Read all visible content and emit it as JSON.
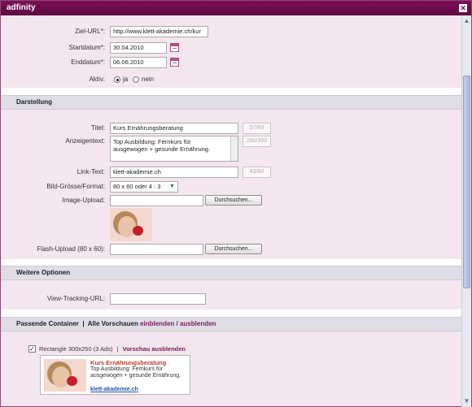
{
  "window": {
    "title": "adfinity",
    "close_glyph": "✕"
  },
  "form": {
    "ziel_url": {
      "label": "Ziel-URL*:",
      "value": "http://www.klett-akademie.ch/kur"
    },
    "startdatum": {
      "label": "Startdatum*:",
      "value": "30.04.2010"
    },
    "enddatum": {
      "label": "Enddatum*:",
      "value": "06.06.2010"
    },
    "aktiv": {
      "label": "Aktiv:",
      "option_ja": "ja",
      "option_nein": "nein",
      "selected": "ja"
    }
  },
  "darstellung": {
    "header": "Darstellung",
    "titel": {
      "label": "Titel:",
      "value": "Kurs Ernährungsberatung",
      "counter": "57/60"
    },
    "anzeigentext": {
      "label": "Anzeigentext:",
      "line1": "Top Ausbildung: Fernkurs für",
      "line2": "ausgewogen + gesunde Ernährung.",
      "counter": "280/350"
    },
    "link_text": {
      "label": "Link-Text:",
      "value": "klett-akademie.ch",
      "counter": "43/60"
    },
    "bild_format": {
      "label": "Bild-Grösse/Format:",
      "value": "80 x 60 oder 4 : 3"
    },
    "image_upload": {
      "label": "Image-Upload:",
      "value": "",
      "button": "Durchsuchen..."
    },
    "flash_upload": {
      "label": "Flash-Upload (80 x 60):",
      "value": "",
      "button": "Durchsuchen..."
    }
  },
  "weitere": {
    "header": "Weitere Optionen",
    "view_tracking": {
      "label": "View-Tracking-URL:",
      "value": ""
    }
  },
  "passende": {
    "header_prefix": "Passende Container  |  Alle Vorschauen ",
    "link_show": "einblenden",
    "separator": " / ",
    "link_hide": "ausblenden",
    "container_label": "Rectangle 300x250 (3 Ads)",
    "container_sep": "|",
    "container_link": "Vorschau ausblenden",
    "checked": true
  },
  "ad_preview": {
    "title": "Kurs Ernährungsberatung",
    "text": "Top Ausbildung: Fernkurs für ausgewogen + gesunde Ernährung.",
    "link": "klett-akademie.ch"
  },
  "icons": {
    "calendar": "calendar-icon",
    "scroll_up": "▲",
    "scroll_down": "▼",
    "select_arrow": "▼",
    "checkmark": "✓"
  },
  "colors": {
    "titlebar": "#6b0d4b",
    "accent": "#7a1a5c",
    "background": "#f4e6ee"
  }
}
